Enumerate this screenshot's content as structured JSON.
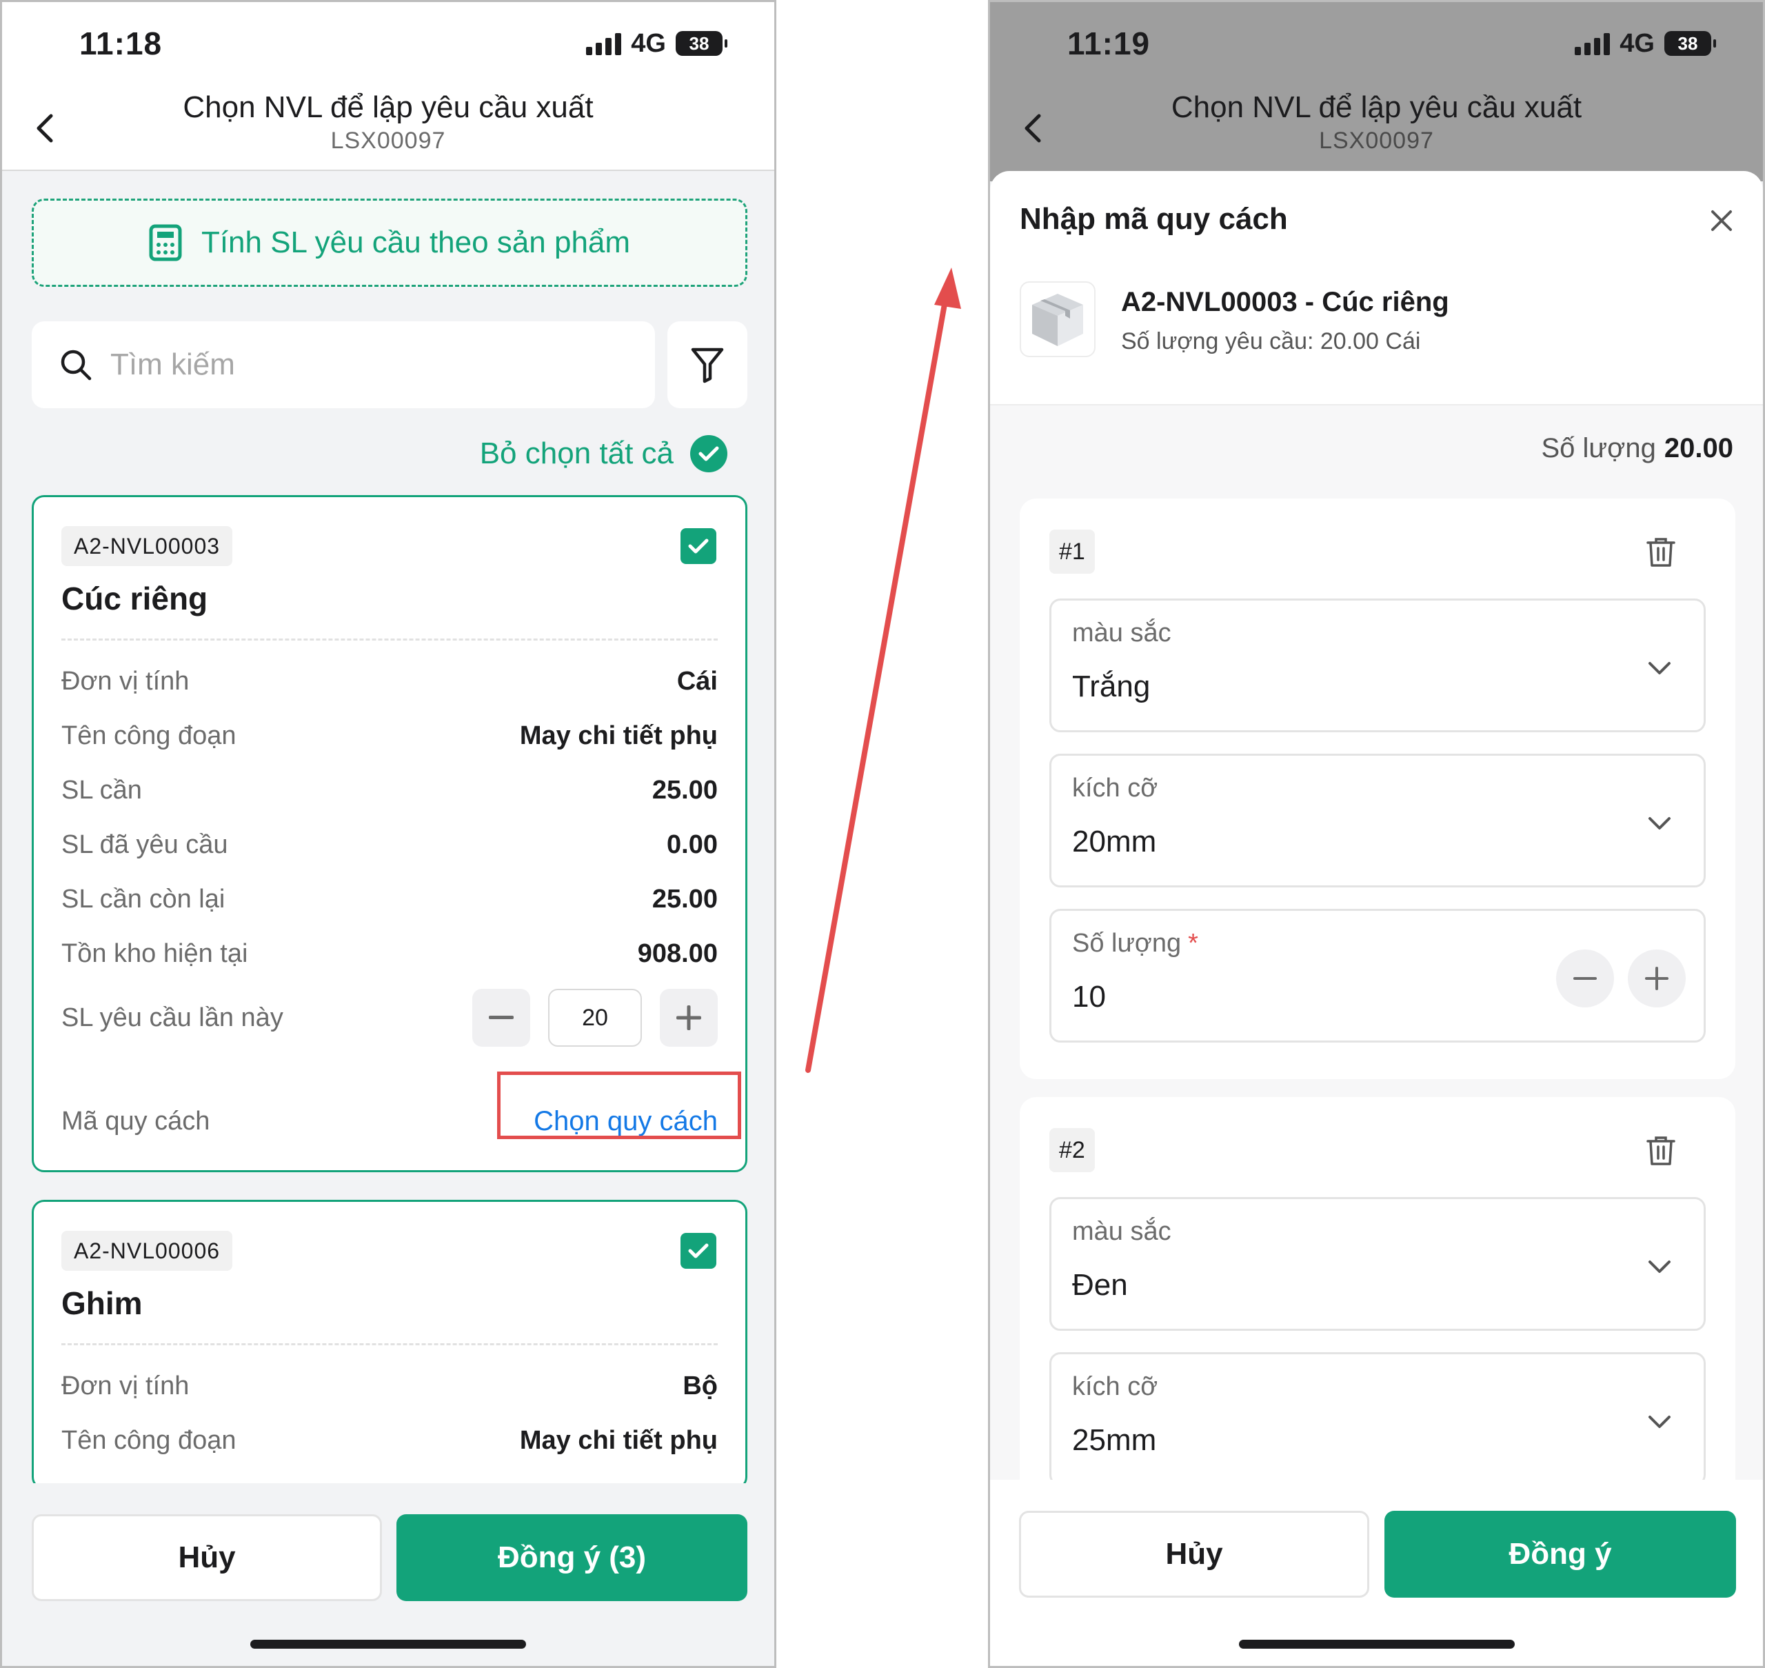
{
  "status_left": {
    "time": "11:18",
    "network": "4G",
    "battery": "38"
  },
  "status_right": {
    "time": "11:19",
    "network": "4G",
    "battery": "38"
  },
  "header": {
    "title": "Chọn NVL để lập yêu cầu xuất",
    "subtitle": "LSX00097"
  },
  "left": {
    "calc_label": "Tính SL yêu cầu theo sản phẩm",
    "search_placeholder": "Tìm kiếm",
    "deselect_label": "Bỏ chọn tất cả",
    "items": [
      {
        "code": "A2-NVL00003",
        "name": "Cúc riêng",
        "rows": [
          {
            "label": "Đơn vị tính",
            "value": "Cái"
          },
          {
            "label": "Tên công đoạn",
            "value": "May chi tiết phụ"
          },
          {
            "label": "SL cần",
            "value": "25.00"
          },
          {
            "label": "SL đã yêu cầu",
            "value": "0.00"
          },
          {
            "label": "SL cần còn lại",
            "value": "25.00"
          },
          {
            "label": "Tồn kho hiện tại",
            "value": "908.00"
          }
        ],
        "request_label": "SL yêu cầu lần này",
        "request_qty": "20",
        "spec_label": "Mã quy cách",
        "spec_action": "Chọn quy cách"
      },
      {
        "code": "A2-NVL00006",
        "name": "Ghim",
        "rows": [
          {
            "label": "Đơn vị tính",
            "value": "Bộ"
          },
          {
            "label": "Tên công đoạn",
            "value": "May chi tiết phụ"
          }
        ]
      }
    ],
    "cancel_label": "Hủy",
    "confirm_label": "Đồng ý (3)"
  },
  "right": {
    "sheet_title": "Nhập mã quy cách",
    "product_name": "A2-NVL00003 - Cúc riêng",
    "product_request": "Số lượng yêu cầu: 20.00 Cái",
    "total_label": "Số lượng",
    "total_value": "20.00",
    "specs": [
      {
        "index": "#1",
        "color_label": "màu sắc",
        "color_value": "Trắng",
        "size_label": "kích cỡ",
        "size_value": "20mm",
        "qty_label": "Số lượng",
        "qty_required": "*",
        "qty_value": "10"
      },
      {
        "index": "#2",
        "color_label": "màu sắc",
        "color_value": "Đen",
        "size_label": "kích cỡ",
        "size_value": "25mm"
      }
    ],
    "cancel_label": "Hủy",
    "confirm_label": "Đồng ý"
  },
  "colors": {
    "primary": "#13a37a",
    "link": "#1479e6",
    "highlight": "#e34d4d"
  }
}
